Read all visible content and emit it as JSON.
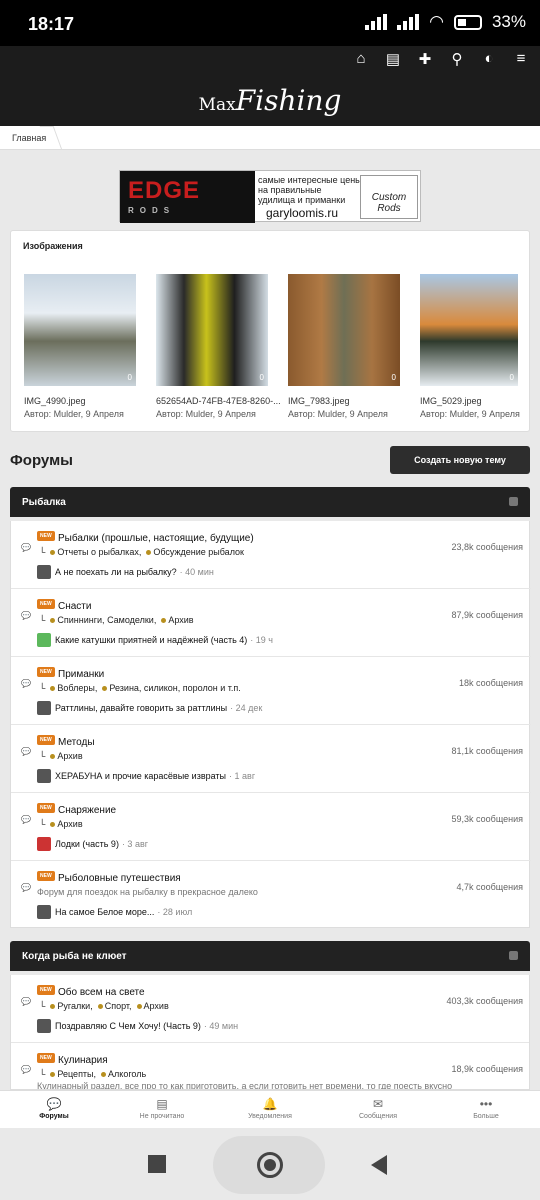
{
  "status": {
    "time": "18:17",
    "battery": "33%"
  },
  "header": {
    "logo_a": "Max",
    "logo_b": "Fishing"
  },
  "breadcrumb": {
    "home": "Главная"
  },
  "banner": {
    "brand": "EDGE",
    "brand_sub": "RODS",
    "tag1": "самые интересные цены",
    "tag2": "на правильные",
    "tag3": "удилища и приманки",
    "url": "garyloomis.ru",
    "arc": "Custom Rods"
  },
  "images": {
    "title": "Изображения",
    "items": [
      {
        "name": "IMG_4990.jpeg",
        "author": "Автор: Mulder, 9 Апреля",
        "comments": "0"
      },
      {
        "name": "652654AD-74FB-47E8-8260-...",
        "author": "Автор: Mulder, 9 Апреля",
        "comments": "0"
      },
      {
        "name": "IMG_7983.jpeg",
        "author": "Автор: Mulder, 9 Апреля",
        "comments": "0"
      },
      {
        "name": "IMG_5029.jpeg",
        "author": "Автор: Mulder, 9 Апреля",
        "comments": "0"
      }
    ]
  },
  "forums": {
    "title": "Форумы",
    "new_topic": "Создать новую тему"
  },
  "cat1": {
    "title": "Рыбалка",
    "nodes": [
      {
        "badge": "NEW",
        "name": "Рыбалки (прошлые, настоящие, будущие)",
        "subs": [
          "Отчеты о рыбалках,",
          "Обсуждение рыбалок"
        ],
        "count": "23,8k сообщения",
        "last": "А не поехать ли на рыбалку?",
        "ago": "· 40 мин"
      },
      {
        "badge": "NEW",
        "name": "Снасти",
        "subs": [
          "Спиннинги,",
          "Самоделки,",
          "Архив"
        ],
        "count": "87,9k сообщения",
        "last": "Какие катушки приятней и надёжней (часть 4)",
        "ago": "· 19 ч"
      },
      {
        "badge": "NEW",
        "name": "Приманки",
        "subs": [
          "Воблеры,",
          "Резина, силикон, поролон и т.п."
        ],
        "count": "18k сообщения",
        "last": "Раттлины, давайте говорить за раттлины",
        "ago": "· 24 дек"
      },
      {
        "badge": "NEW",
        "name": "Методы",
        "subs": [
          "Архив"
        ],
        "count": "81,1k сообщения",
        "last": "ХЕРАБУНА и прочие карасёвые извраты",
        "ago": "· 1 авг"
      },
      {
        "badge": "NEW",
        "name": "Снаряжение",
        "subs": [
          "Архив"
        ],
        "count": "59,3k сообщения",
        "last": "Лодки (часть 9)",
        "ago": "· 3 авг"
      },
      {
        "badge": "NEW",
        "name": "Рыболовные путешествия",
        "desc": "Форум для поездок на рыбалку в прекрасное далеко",
        "count": "4,7k сообщения",
        "last": "На самое Белое море...",
        "ago": "· 28 июл"
      }
    ]
  },
  "cat2": {
    "title": "Когда рыба не клюет",
    "nodes": [
      {
        "badge": "NEW",
        "name": "Обо всем на свете",
        "subs": [
          "Ругалки,",
          "Спорт,",
          "Архив"
        ],
        "count": "403,3k сообщения",
        "last": "Поздравляю С Чем Хочу! (Часть 9)",
        "ago": "· 49 мин"
      },
      {
        "badge": "NEW",
        "name": "Кулинария",
        "subs": [
          "Рецепты,",
          "Алкоголь"
        ],
        "count": "18,9k сообщения",
        "desc2": "Кулинарный раздел, все про то как приготовить, а если готовить нет времени, то где поесть вкусно"
      }
    ]
  },
  "tabs": [
    {
      "icon": "forums-icon",
      "label": "Форумы"
    },
    {
      "icon": "unread-icon",
      "label": "Не прочитано"
    },
    {
      "icon": "bell-icon",
      "label": "Уведомления"
    },
    {
      "icon": "mail-icon",
      "label": "Сообщения"
    },
    {
      "icon": "more-icon",
      "label": "Больше"
    }
  ]
}
